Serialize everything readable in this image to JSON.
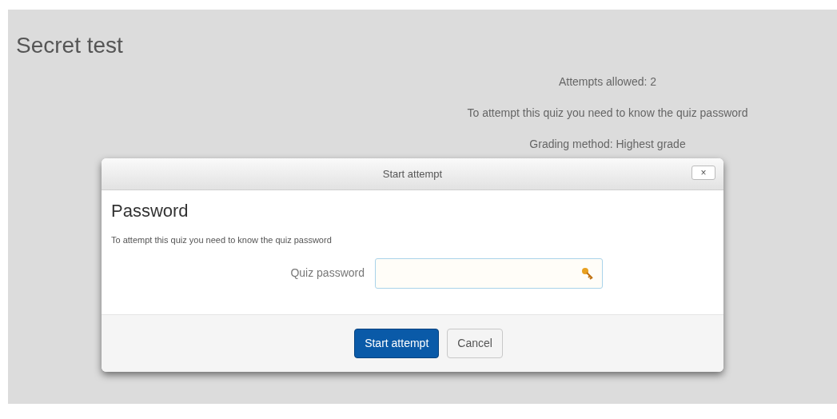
{
  "page": {
    "title": "Secret test",
    "info": [
      "Attempts allowed: 2",
      "To attempt this quiz you need to know the quiz password",
      "Grading method: Highest grade"
    ]
  },
  "dialog": {
    "title": "Start attempt",
    "close": "×",
    "heading": "Password",
    "description": "To attempt this quiz you need to know the quiz password",
    "field": {
      "label": "Quiz password"
    },
    "buttons": [
      {
        "label": "Start attempt",
        "kind": "primary"
      },
      {
        "label": "Cancel",
        "kind": "secondary"
      }
    ]
  }
}
